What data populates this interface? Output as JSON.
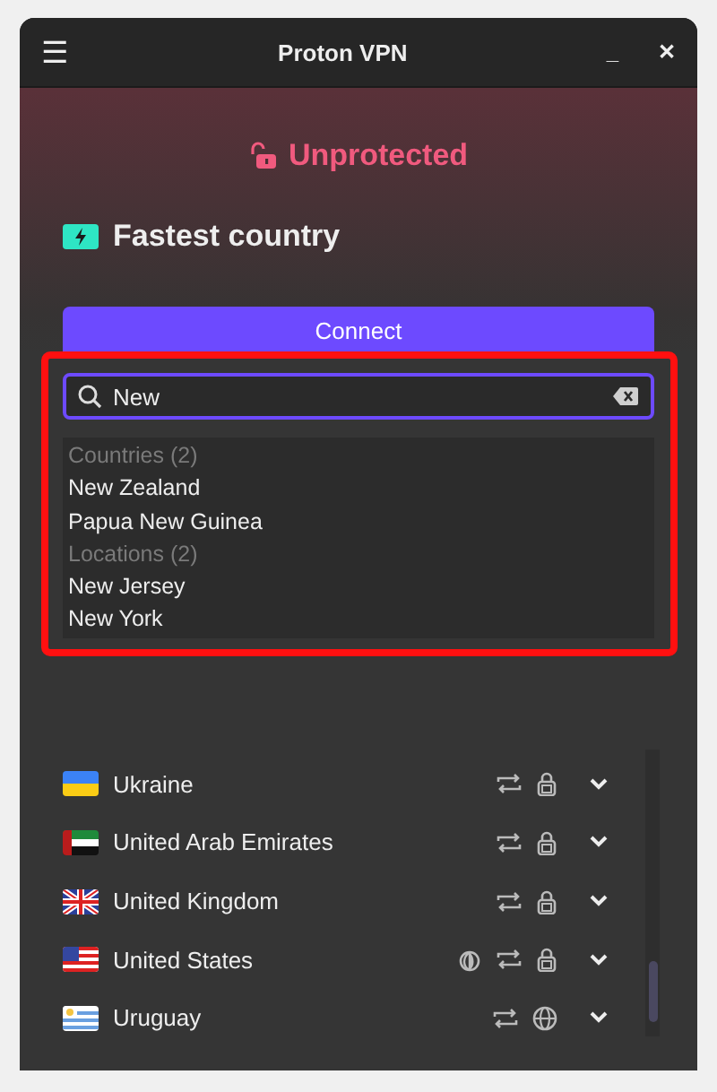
{
  "window": {
    "title": "Proton VPN",
    "menu_glyph": "☰",
    "minimize_glyph": "_",
    "close_glyph": "✕"
  },
  "status": {
    "text": "Unprotected",
    "protected": false
  },
  "profile": {
    "label": "Fastest country"
  },
  "connect_button": {
    "label": "Connect"
  },
  "search": {
    "value": "New"
  },
  "results": [
    {
      "kind": "header",
      "text": "Countries (2)"
    },
    {
      "kind": "item",
      "text": "New Zealand"
    },
    {
      "kind": "item",
      "text": "Papua New Guinea"
    },
    {
      "kind": "header",
      "text": "Locations (2)"
    },
    {
      "kind": "item",
      "text": "New Jersey"
    },
    {
      "kind": "item",
      "text": "New York"
    }
  ],
  "countries": [
    {
      "name": "Ukraine",
      "features": [
        {
          "kind": "p2p"
        },
        {
          "kind": "secure"
        }
      ]
    },
    {
      "name": "United Arab Emirates",
      "features": [
        {
          "kind": "p2p"
        },
        {
          "kind": "secure"
        }
      ]
    },
    {
      "name": "United Kingdom",
      "features": [
        {
          "kind": "p2p"
        },
        {
          "kind": "secure"
        }
      ]
    },
    {
      "name": "United States",
      "features": [
        {
          "kind": "tor"
        },
        {
          "kind": "p2p"
        },
        {
          "kind": "secure"
        }
      ]
    },
    {
      "name": "Uruguay",
      "features": [
        {
          "kind": "p2p"
        },
        {
          "kind": "globe"
        }
      ]
    }
  ]
}
